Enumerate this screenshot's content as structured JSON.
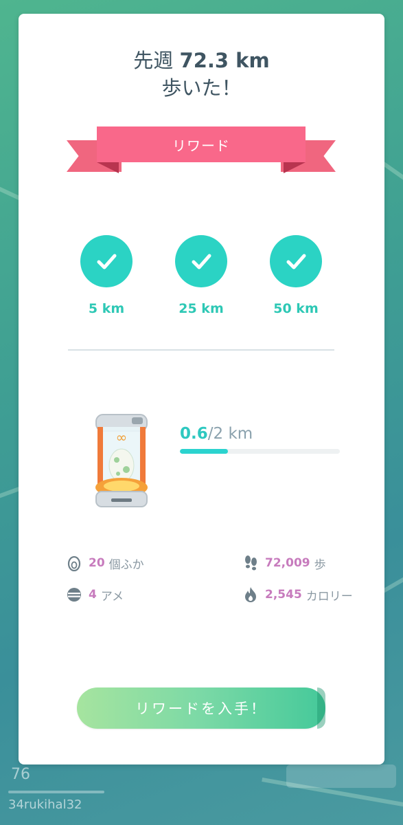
{
  "header": {
    "prefix": "先週",
    "distance": "72.3 km",
    "line2": "歩いた！"
  },
  "ribbon": {
    "label": "リワード"
  },
  "milestones": [
    {
      "label": "5 km",
      "icon": "check-icon",
      "achieved": true
    },
    {
      "label": "25 km",
      "icon": "check-icon",
      "achieved": true
    },
    {
      "label": "50 km",
      "icon": "check-icon",
      "achieved": true
    }
  ],
  "incubator": {
    "icon": "infinite-incubator-icon",
    "current": "0.6",
    "total": "/2 km",
    "progress_fraction": 0.3
  },
  "stats": {
    "hatched": {
      "icon": "egg-icon",
      "value": "20",
      "label": "個ふか"
    },
    "steps": {
      "icon": "footsteps-icon",
      "value": "72,009",
      "label": "歩"
    },
    "candy": {
      "icon": "candy-icon",
      "value": "4",
      "label": "アメ"
    },
    "calories": {
      "icon": "flame-icon",
      "value": "2,545",
      "label": "カロリー"
    }
  },
  "button": {
    "label": "リワードを入手！"
  },
  "hud": {
    "level": "76",
    "username": "34rukihal32"
  },
  "colors": {
    "accent_teal": "#2bd3c4",
    "ribbon_pink": "#f9688a",
    "stat_value": "#c77bbd",
    "title_text": "#3f5562"
  }
}
